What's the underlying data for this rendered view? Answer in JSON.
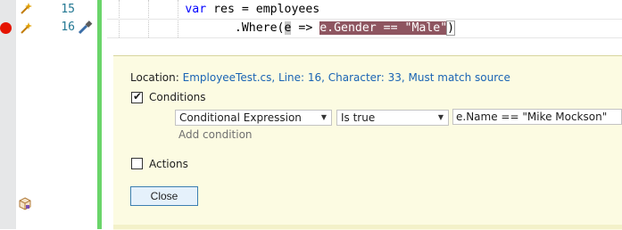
{
  "editor": {
    "lines": [
      {
        "number": "15",
        "code": {
          "indent": "           ",
          "kw": "var",
          "rest": " res = employees"
        }
      },
      {
        "number": "16",
        "code": {
          "indent": "                  ",
          "p1": ".Where(",
          "param": "e",
          "arrow": " => ",
          "sel": "e.Gender == ",
          "selstr": "\"Male\"",
          "close": ")"
        }
      }
    ]
  },
  "breakpoint_settings": {
    "location_label": "Location: ",
    "location_link": "EmployeeTest.cs, Line: 16, Character: 33, Must match source",
    "conditions": {
      "checked": true,
      "label": "Conditions",
      "type_value": "Conditional Expression",
      "operator_value": "Is true",
      "expression_value": "e.Name == \"Mike Mockson\"",
      "add_condition": "Add condition"
    },
    "actions": {
      "checked": false,
      "label": "Actions"
    },
    "close_label": "Close"
  },
  "colors": {
    "breakpoint": "#e51400",
    "green_bar": "#6ad56a",
    "peek_background": "#fcfbe2",
    "selection": "#8e5560"
  }
}
